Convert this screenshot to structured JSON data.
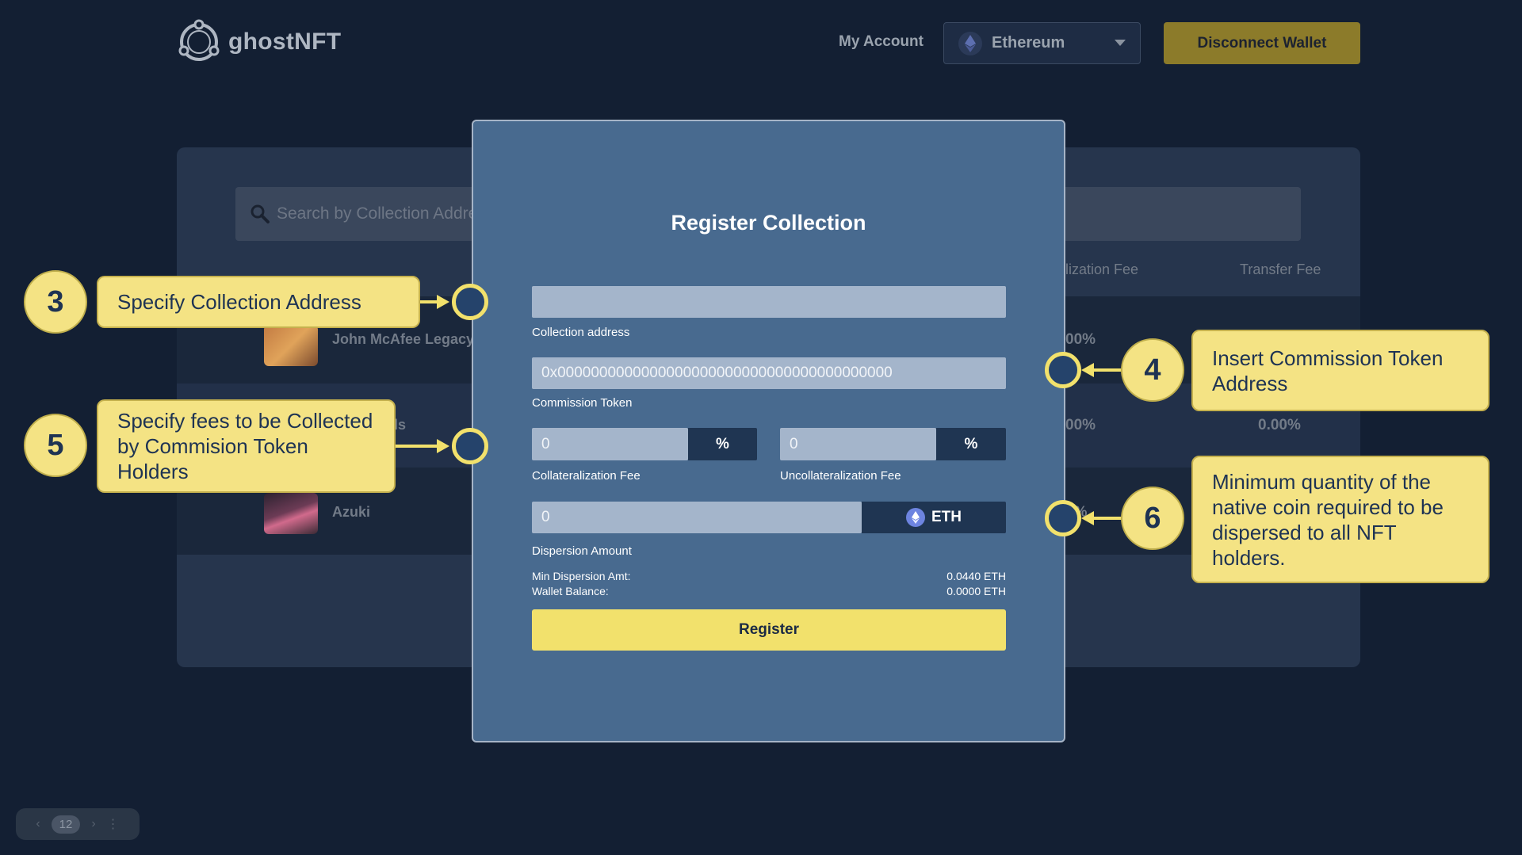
{
  "header": {
    "logo_text": "ghostNFT",
    "my_account": "My Account",
    "network": "Ethereum",
    "disconnect": "Disconnect Wallet"
  },
  "background": {
    "search_placeholder": "Search by Collection Address",
    "columns": [
      "ralization Fee",
      "Transfer Fee"
    ],
    "rows": [
      {
        "name": "John McAfee Legacy",
        "col1": "00%",
        "col2": ""
      },
      {
        "name": "ls",
        "col1": "00%",
        "col2": "0.00%"
      },
      {
        "name": "Azuki",
        "col1": "0%",
        "col2": ""
      }
    ],
    "pager": {
      "prev": "‹",
      "page": "12",
      "next": "›",
      "more": "⋮"
    }
  },
  "modal": {
    "title": "Register Collection",
    "collection_address": {
      "value": "",
      "label": "Collection address"
    },
    "commission_token": {
      "value": "0x0000000000000000000000000000000000000000",
      "label": "Commission Token"
    },
    "collateralization_fee": {
      "value": "0",
      "suffix": "%",
      "label": "Collateralization Fee"
    },
    "uncollateralization_fee": {
      "value": "0",
      "suffix": "%",
      "label": "Uncollateralization Fee"
    },
    "dispersion_amount": {
      "value": "0",
      "suffix": "ETH",
      "label": "Dispersion Amount"
    },
    "min_dispersion": {
      "label": "Min Dispersion Amt:",
      "value": "0.0440 ETH"
    },
    "wallet_balance": {
      "label": "Wallet Balance:",
      "value": "0.0000 ETH"
    },
    "register": "Register"
  },
  "callouts": [
    {
      "number": "3",
      "text": "Specify Collection Address"
    },
    {
      "number": "4",
      "text": "Insert Commission Token Address"
    },
    {
      "number": "5",
      "text": "Specify fees to be Collected by Commision Token Holders"
    },
    {
      "number": "6",
      "text": "Minimum quantity of the native coin required to be dispersed to all NFT holders."
    }
  ],
  "colors": {
    "accent_yellow": "#f2e16c",
    "modal_bg": "#486a8f",
    "page_bg": "#131f33",
    "callout_dot": "#25436b"
  }
}
